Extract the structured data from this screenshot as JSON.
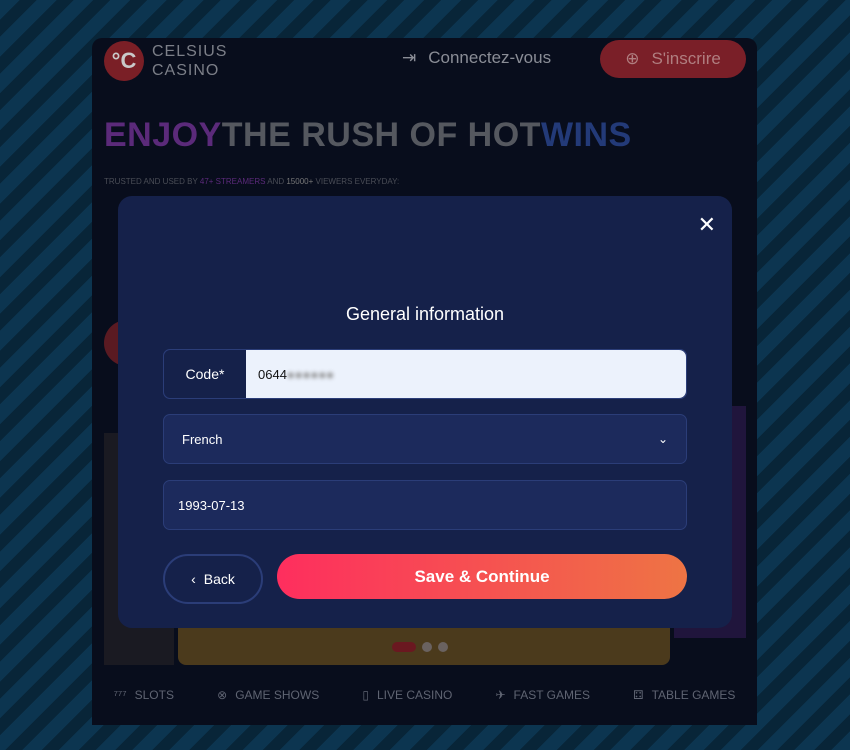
{
  "header": {
    "logo_top": "CELSIUS",
    "logo_bottom": "CASINO",
    "login": "Connectez-vous",
    "signup": "S'inscrire"
  },
  "hero": {
    "part1": "ENJOY",
    "part2": "THE RUSH OF HOT",
    "part3": "WINS"
  },
  "trust": {
    "t1": "TRUSTED AND USED BY ",
    "t2": "47+ STREAMERS",
    "t3": " AND ",
    "t4": "15000+",
    "t5": " VIEWERS EVERYDAY:"
  },
  "nav": [
    {
      "label": "SLOTS",
      "icon": "slots-icon"
    },
    {
      "label": "GAME SHOWS",
      "icon": "wheel-icon"
    },
    {
      "label": "LIVE CASINO",
      "icon": "card-icon"
    },
    {
      "label": "FAST GAMES",
      "icon": "plane-icon"
    },
    {
      "label": "TABLE GAMES",
      "icon": "table-icon"
    }
  ],
  "modal": {
    "title": "General information",
    "code_label": "Code*",
    "code_value": "0644",
    "language": "French",
    "birthdate": "1993-07-13",
    "back": "Back",
    "save": "Save & Continue"
  },
  "colors": {
    "accent_start": "#fe2e5e",
    "accent_end": "#ee7444",
    "modal_bg": "#15214a"
  }
}
